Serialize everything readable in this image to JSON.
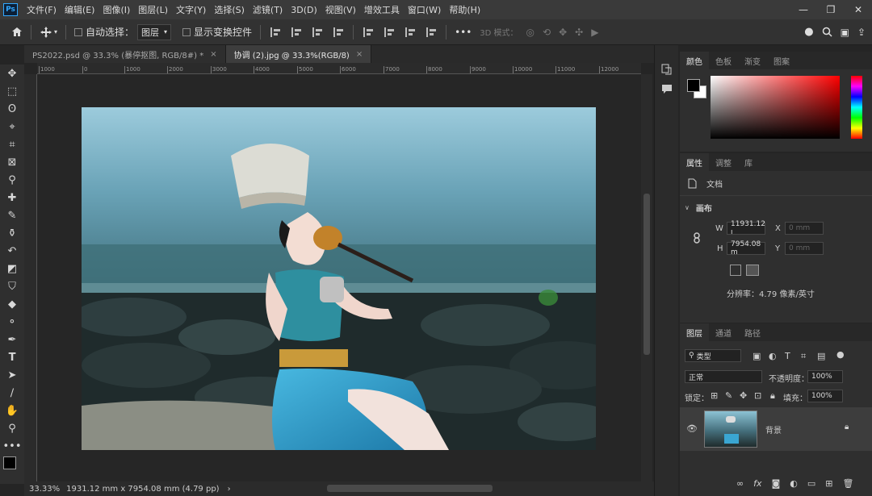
{
  "menu": {
    "items": [
      "文件(F)",
      "编辑(E)",
      "图像(I)",
      "图层(L)",
      "文字(Y)",
      "选择(S)",
      "滤镜(T)",
      "3D(D)",
      "视图(V)",
      "增效工具",
      "窗口(W)",
      "帮助(H)"
    ],
    "logo": "Ps"
  },
  "window_controls": {
    "minimize": "—",
    "restore": "❐",
    "close": "✕"
  },
  "options_bar": {
    "auto_select_label": "自动选择：",
    "auto_select_target": "图层",
    "show_transform_label": "显示变换控件",
    "more": "•••",
    "mode_3d_label": "3D 模式："
  },
  "tabs": [
    {
      "label": "PS2022.psd @ 33.3% (暴停抠图, RGB/8#) *",
      "close": "×",
      "active": false
    },
    {
      "label": "协调 (2).jpg @ 33.3%(RGB/8)",
      "close": "×",
      "active": true
    }
  ],
  "ruler_labels": [
    "1000",
    "0",
    "1000",
    "2000",
    "3000",
    "4000",
    "5000",
    "6000",
    "7000",
    "8000",
    "9000",
    "10000",
    "11000",
    "12000"
  ],
  "status": {
    "zoom": "33.33%",
    "doc_info": "1931.12 mm x 7954.08 mm (4.79 pp)",
    "arrow": "›"
  },
  "color_panel": {
    "tabs": [
      "颜色",
      "色板",
      "渐变",
      "图案"
    ],
    "fg_color": "#000000",
    "bg_color": "#ffffff",
    "hue_color": "#ff0000"
  },
  "properties_panel": {
    "tabs": [
      "属性",
      "调整",
      "库"
    ],
    "doc_label": "文档",
    "canvas_section": "画布",
    "w_label": "W",
    "w_value": "11931.12 ı",
    "x_label": "X",
    "x_placeholder": "0 mm",
    "h_label": "H",
    "h_value": "7954.08 m",
    "y_label": "Y",
    "y_placeholder": "0 mm",
    "resolution": "分辨率：4.79 像素/英寸"
  },
  "layers_panel": {
    "tabs": [
      "图层",
      "通道",
      "路径"
    ],
    "filter_label": "类型",
    "blend_mode": "正常",
    "opacity_label": "不透明度：",
    "opacity_value": "100%",
    "lock_label": "锁定：",
    "fill_label": "填充：",
    "fill_value": "100%",
    "layer_name": "背景",
    "bottom_fx": "fx"
  }
}
